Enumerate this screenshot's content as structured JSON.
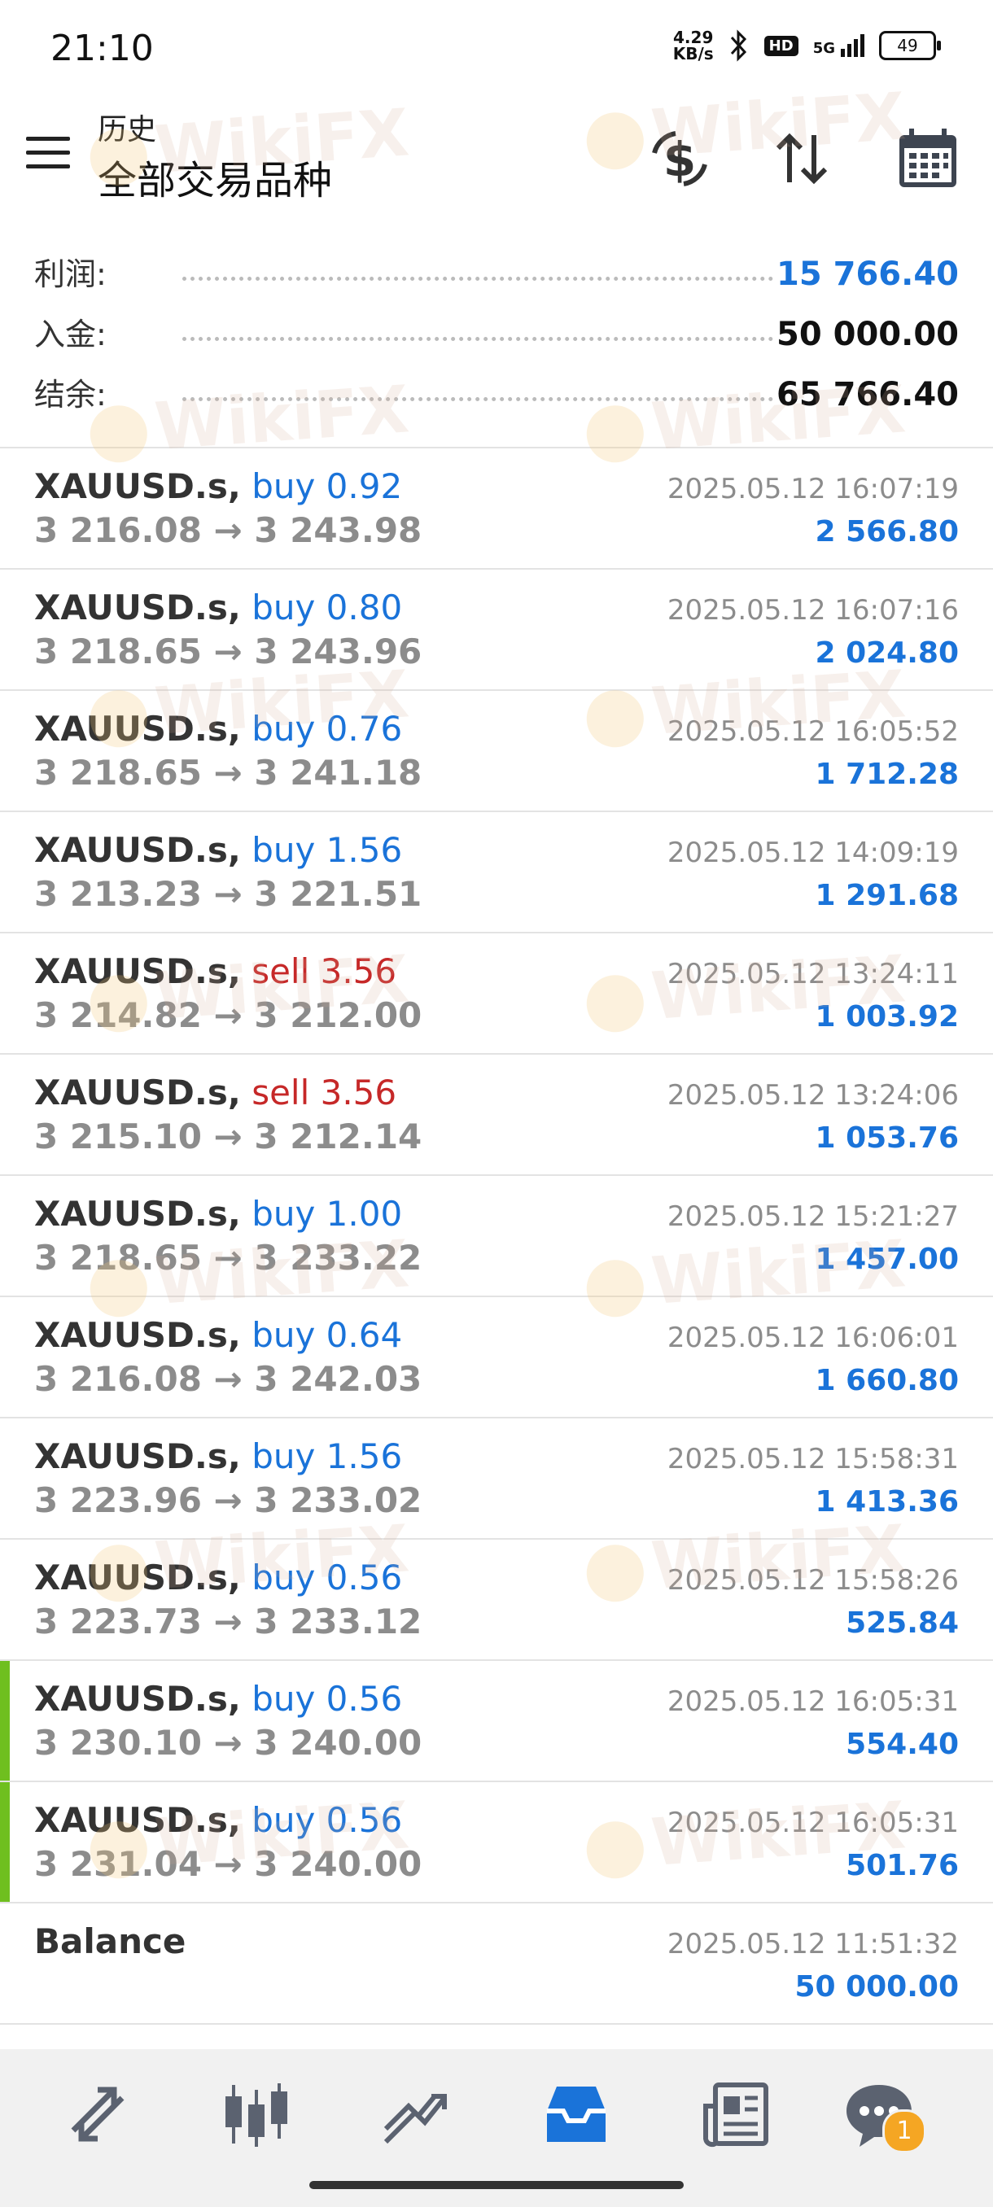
{
  "status_bar": {
    "time": "21:10",
    "net_speed_value": "4.29",
    "net_speed_unit": "KB/s",
    "hd": "HD",
    "signal": "5G",
    "battery": "49"
  },
  "header": {
    "subtitle": "历史",
    "title": "全部交易品种",
    "icons": [
      "currency-exchange-icon",
      "sort-icon",
      "calendar-icon"
    ]
  },
  "summary": {
    "profit_label": "利润:",
    "profit_value": "15 766.40",
    "deposit_label": "入金:",
    "deposit_value": "50 000.00",
    "balance_label": "结余:",
    "balance_value": "65 766.40"
  },
  "trades": [
    {
      "symbol": "XAUUSD.s,",
      "side": "buy",
      "side_text": "buy 0.92",
      "prices": "3 216.08 → 3 243.98",
      "time": "2025.05.12 16:07:19",
      "profit": "2 566.80",
      "marked": false
    },
    {
      "symbol": "XAUUSD.s,",
      "side": "buy",
      "side_text": "buy 0.80",
      "prices": "3 218.65 → 3 243.96",
      "time": "2025.05.12 16:07:16",
      "profit": "2 024.80",
      "marked": false
    },
    {
      "symbol": "XAUUSD.s,",
      "side": "buy",
      "side_text": "buy 0.76",
      "prices": "3 218.65 → 3 241.18",
      "time": "2025.05.12 16:05:52",
      "profit": "1 712.28",
      "marked": false
    },
    {
      "symbol": "XAUUSD.s,",
      "side": "buy",
      "side_text": "buy 1.56",
      "prices": "3 213.23 → 3 221.51",
      "time": "2025.05.12 14:09:19",
      "profit": "1 291.68",
      "marked": false
    },
    {
      "symbol": "XAUUSD.s,",
      "side": "sell",
      "side_text": "sell 3.56",
      "prices": "3 214.82 → 3 212.00",
      "time": "2025.05.12 13:24:11",
      "profit": "1 003.92",
      "marked": false
    },
    {
      "symbol": "XAUUSD.s,",
      "side": "sell",
      "side_text": "sell 3.56",
      "prices": "3 215.10 → 3 212.14",
      "time": "2025.05.12 13:24:06",
      "profit": "1 053.76",
      "marked": false
    },
    {
      "symbol": "XAUUSD.s,",
      "side": "buy",
      "side_text": "buy 1.00",
      "prices": "3 218.65 → 3 233.22",
      "time": "2025.05.12 15:21:27",
      "profit": "1 457.00",
      "marked": false
    },
    {
      "symbol": "XAUUSD.s,",
      "side": "buy",
      "side_text": "buy 0.64",
      "prices": "3 216.08 → 3 242.03",
      "time": "2025.05.12 16:06:01",
      "profit": "1 660.80",
      "marked": false
    },
    {
      "symbol": "XAUUSD.s,",
      "side": "buy",
      "side_text": "buy 1.56",
      "prices": "3 223.96 → 3 233.02",
      "time": "2025.05.12 15:58:31",
      "profit": "1 413.36",
      "marked": false
    },
    {
      "symbol": "XAUUSD.s,",
      "side": "buy",
      "side_text": "buy 0.56",
      "prices": "3 223.73 → 3 233.12",
      "time": "2025.05.12 15:58:26",
      "profit": "525.84",
      "marked": false
    },
    {
      "symbol": "XAUUSD.s,",
      "side": "buy",
      "side_text": "buy 0.56",
      "prices": "3 230.10 → 3 240.00",
      "time": "2025.05.12 16:05:31",
      "profit": "554.40",
      "marked": true
    },
    {
      "symbol": "XAUUSD.s,",
      "side": "buy",
      "side_text": "buy 0.56",
      "prices": "3 231.04 → 3 240.00",
      "time": "2025.05.12 16:05:31",
      "profit": "501.76",
      "marked": true
    }
  ],
  "balance_entry": {
    "label": "Balance",
    "time": "2025.05.12 11:51:32",
    "amount": "50 000.00"
  },
  "bottom_nav": {
    "items": [
      "quotes-icon",
      "chart-icon",
      "trade-icon",
      "history-icon",
      "news-icon",
      "messages-icon"
    ],
    "active": "history-icon",
    "messages_badge": "1"
  },
  "watermark": "WikiFX",
  "colors": {
    "accent_blue": "#1a73d9",
    "sell_red": "#c62828",
    "marker_green": "#6fbf1f",
    "badge_orange": "#f5a623"
  }
}
